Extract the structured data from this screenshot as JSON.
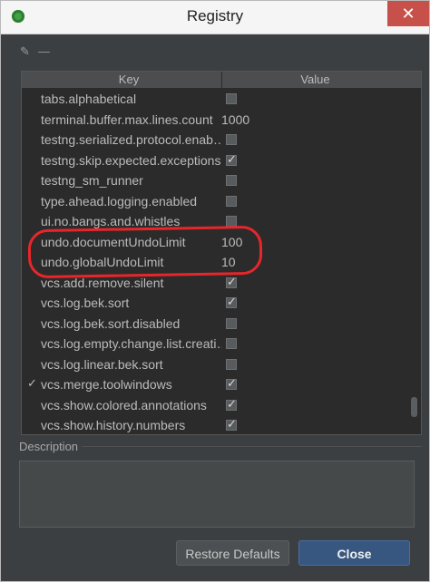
{
  "window": {
    "title": "Registry",
    "close_glyph": "✕"
  },
  "toolbar": {
    "edit_icon": "edit-icon",
    "edit_glyph": "✎",
    "remove_icon": "remove-icon",
    "remove_glyph": "—"
  },
  "table": {
    "headers": {
      "key": "Key",
      "value": "Value"
    },
    "rows": [
      {
        "key": "tabs.alphabetical",
        "value": "",
        "type": "checkbox",
        "checked": false,
        "modified": false
      },
      {
        "key": "terminal.buffer.max.lines.count",
        "value": "1000",
        "type": "text",
        "modified": false
      },
      {
        "key": "testng.serialized.protocol.enab…",
        "value": "",
        "type": "checkbox",
        "checked": false,
        "modified": false
      },
      {
        "key": "testng.skip.expected.exceptions",
        "value": "",
        "type": "checkbox",
        "checked": true,
        "modified": false
      },
      {
        "key": "testng_sm_runner",
        "value": "",
        "type": "checkbox",
        "checked": false,
        "modified": false
      },
      {
        "key": "type.ahead.logging.enabled",
        "value": "",
        "type": "checkbox",
        "checked": false,
        "modified": false
      },
      {
        "key": "ui.no.bangs.and.whistles",
        "value": "",
        "type": "checkbox",
        "checked": false,
        "modified": false
      },
      {
        "key": "undo.documentUndoLimit",
        "value": "100",
        "type": "text",
        "modified": false
      },
      {
        "key": "undo.globalUndoLimit",
        "value": "10",
        "type": "text",
        "modified": false
      },
      {
        "key": "vcs.add.remove.silent",
        "value": "",
        "type": "checkbox",
        "checked": true,
        "modified": false
      },
      {
        "key": "vcs.log.bek.sort",
        "value": "",
        "type": "checkbox",
        "checked": true,
        "modified": false
      },
      {
        "key": "vcs.log.bek.sort.disabled",
        "value": "",
        "type": "checkbox",
        "checked": false,
        "modified": false
      },
      {
        "key": "vcs.log.empty.change.list.creati…",
        "value": "",
        "type": "checkbox",
        "checked": false,
        "modified": false
      },
      {
        "key": "vcs.log.linear.bek.sort",
        "value": "",
        "type": "checkbox",
        "checked": false,
        "modified": false
      },
      {
        "key": "vcs.merge.toolwindows",
        "value": "",
        "type": "checkbox",
        "checked": true,
        "modified": true
      },
      {
        "key": "vcs.show.colored.annotations",
        "value": "",
        "type": "checkbox",
        "checked": true,
        "modified": false
      },
      {
        "key": "vcs.show.history.numbers",
        "value": "",
        "type": "checkbox",
        "checked": true,
        "modified": false
      }
    ]
  },
  "description": {
    "label": "Description",
    "text": ""
  },
  "buttons": {
    "restore": "Restore Defaults",
    "close": "Close"
  },
  "colors": {
    "background": "#3c3f41",
    "table_bg": "#2b2b2b",
    "text": "#bbbbbb",
    "close_button": "#375780",
    "annotation": "#e8262a"
  }
}
